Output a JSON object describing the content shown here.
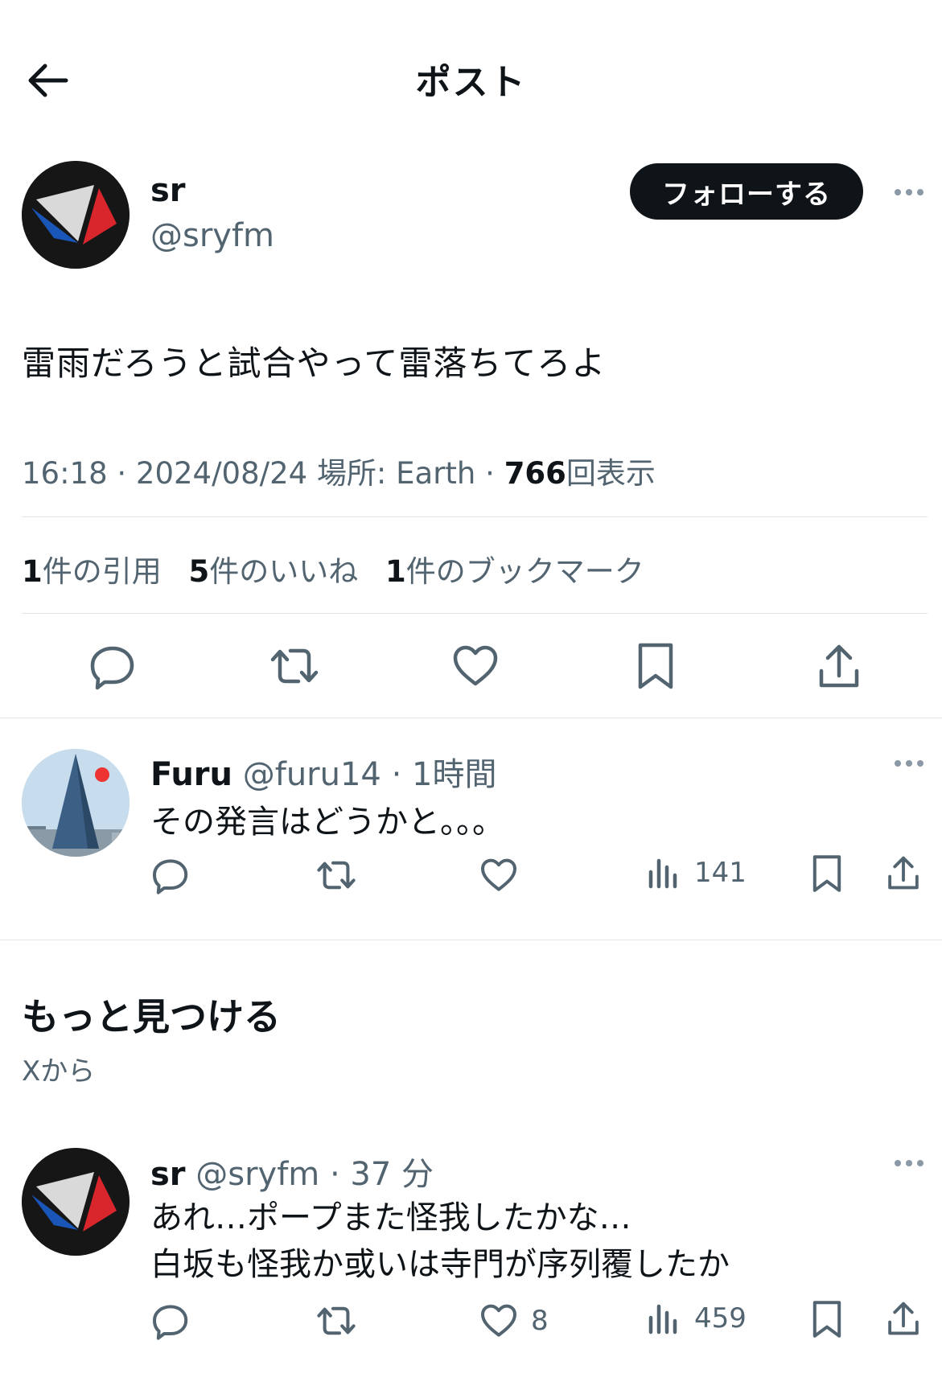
{
  "header": {
    "title": "ポスト",
    "back_icon": "arrow-left-icon"
  },
  "post": {
    "author_name": "sr",
    "author_handle": "@sryfm",
    "follow_label": "フォローする",
    "text": "雷雨だろうと試合やって雷落ちてろよ",
    "time": "16:18 · 2024/08/24",
    "location": "場所: Earth ·",
    "views_count": "766",
    "views_label": "回表示",
    "stats": [
      {
        "count": "1",
        "label": "件の引用"
      },
      {
        "count": "5",
        "label": "件のいいね"
      },
      {
        "count": "1",
        "label": "件のブックマーク"
      }
    ],
    "actions": [
      "reply-icon",
      "repost-icon",
      "like-icon",
      "bookmark-icon",
      "share-icon"
    ]
  },
  "reply": {
    "author_name": "Furu",
    "author_handle": "@furu14",
    "time": "· 1時間",
    "text": "その発言はどうかと。。。",
    "views": "141"
  },
  "discover": {
    "title": "もっと見つける",
    "subtitle": "Xから"
  },
  "related": {
    "author_name": "sr",
    "author_handle": "@sryfm",
    "time": "· 37 分",
    "text_line1": "あれ…ポープまた怪我したかな…",
    "text_line2": "白坂も怪我か或いは寺門が序列覆したか",
    "likes": "8",
    "views": "459"
  },
  "colors": {
    "text": "#0f1419",
    "muted": "#536471",
    "divider": "#e1e6ea",
    "logo_blue": "#1a56b8",
    "logo_red": "#d8262c"
  }
}
